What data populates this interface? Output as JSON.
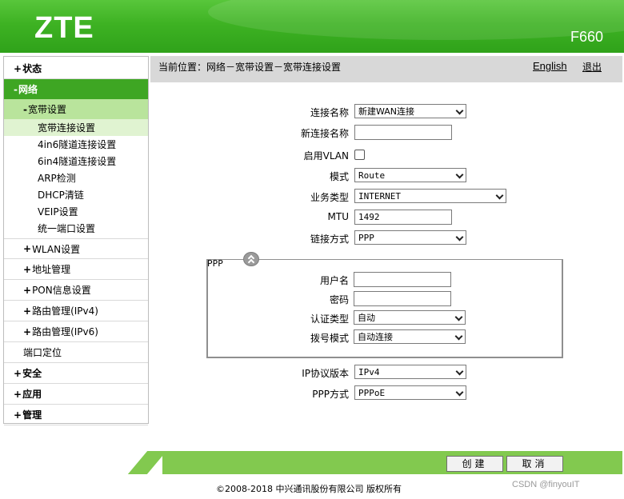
{
  "header": {
    "logo": "ZTE",
    "model": "F660"
  },
  "breadcrumb": {
    "text": "当前位置：网络－宽带设置－宽带连接设置"
  },
  "top_links": {
    "language": "English",
    "logout": "退出"
  },
  "sidebar": {
    "status": {
      "plus": "+",
      "label": "状态"
    },
    "network": {
      "plus": "-",
      "label": "网络"
    },
    "broadband": {
      "plus": "-",
      "label": "宽带设置"
    },
    "leaves": [
      "宽带连接设置",
      "4in6隧道连接设置",
      "6in4隧道连接设置",
      "ARP检测",
      "DHCP清链",
      "VEIP设置",
      "统一端口设置"
    ],
    "wlan": {
      "plus": "+",
      "label": "WLAN设置"
    },
    "address": {
      "plus": "+",
      "label": "地址管理"
    },
    "pon": {
      "plus": "+",
      "label": "PON信息设置"
    },
    "route4": {
      "plus": "+",
      "label": "路由管理(IPv4)"
    },
    "route6": {
      "plus": "+",
      "label": "路由管理(IPv6)"
    },
    "port_locate": {
      "label": "端口定位"
    },
    "security": {
      "plus": "+",
      "label": "安全"
    },
    "application": {
      "plus": "+",
      "label": "应用"
    },
    "management": {
      "plus": "+",
      "label": "管理"
    }
  },
  "form": {
    "connection_name": {
      "label": "连接名称",
      "value": "新建WAN连接"
    },
    "new_connection_name": {
      "label": "新连接名称",
      "value": ""
    },
    "enable_vlan": {
      "label": "启用VLAN",
      "checked": false
    },
    "mode": {
      "label": "模式",
      "value": "Route"
    },
    "service_type": {
      "label": "业务类型",
      "value": "INTERNET"
    },
    "mtu": {
      "label": "MTU",
      "value": "1492"
    },
    "link_type": {
      "label": "链接方式",
      "value": "PPP"
    },
    "ppp": {
      "title": "PPP",
      "username": {
        "label": "用户名",
        "value": ""
      },
      "password": {
        "label": "密码",
        "value": ""
      },
      "auth_type": {
        "label": "认证类型",
        "value": "自动"
      },
      "dial_mode": {
        "label": "拨号模式",
        "value": "自动连接"
      }
    },
    "ip_version": {
      "label": "IP协议版本",
      "value": "IPv4"
    },
    "ppp_mode": {
      "label": "PPP方式",
      "value": "PPPoE"
    }
  },
  "buttons": {
    "create": "创建",
    "cancel": "取消"
  },
  "footer": {
    "copyright": "©2008-2018 中兴通讯股份有限公司 版权所有",
    "watermark": "CSDN @finyouIT"
  },
  "colors": {
    "header_green": "#3eb223",
    "active_nav": "#3ea623",
    "active_sub": "#b9e49c",
    "bar_green": "#82c94f"
  }
}
